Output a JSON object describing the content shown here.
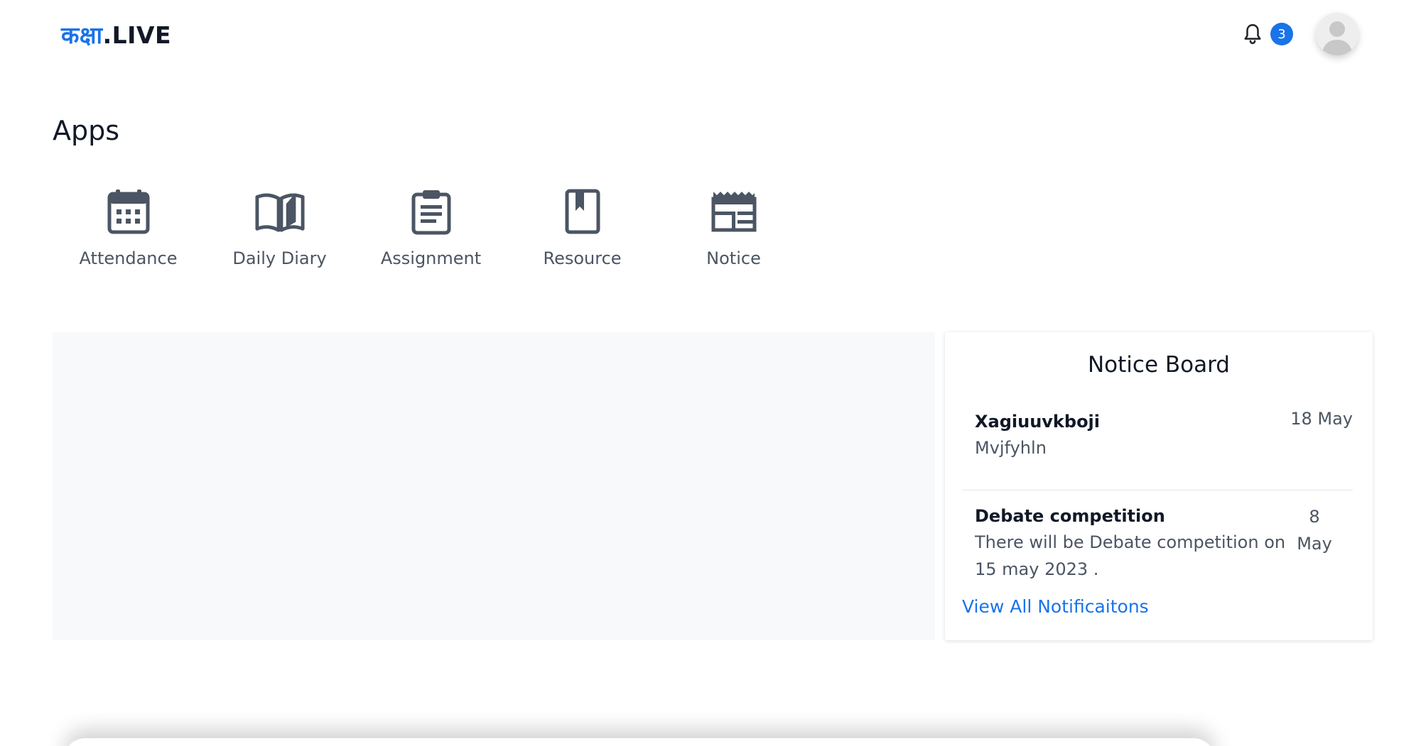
{
  "header": {
    "logo_hindi": "कक्षा",
    "logo_suffix": ".LIVE",
    "notification_count": "3"
  },
  "apps": {
    "title": "Apps",
    "items": [
      {
        "label": "Attendance",
        "icon": "calendar-icon"
      },
      {
        "label": "Daily Diary",
        "icon": "open-book-icon"
      },
      {
        "label": "Assignment",
        "icon": "clipboard-icon"
      },
      {
        "label": "Resource",
        "icon": "bookmark-book-icon"
      },
      {
        "label": "Notice",
        "icon": "newspaper-icon"
      }
    ]
  },
  "notice_board": {
    "title": "Notice Board",
    "items": [
      {
        "title": "Xagiuuvkboji",
        "description": "Mvjfyhln",
        "date": "18 May"
      },
      {
        "title": "Debate competition",
        "description": "There will be Debate competition on 15 may 2023 .",
        "date": "8 May"
      }
    ],
    "view_all_label": "View All Notificaitons"
  },
  "colors": {
    "brand": "#1a73e8",
    "icon": "#4b5563",
    "panel_bg": "#f8f9fa"
  }
}
